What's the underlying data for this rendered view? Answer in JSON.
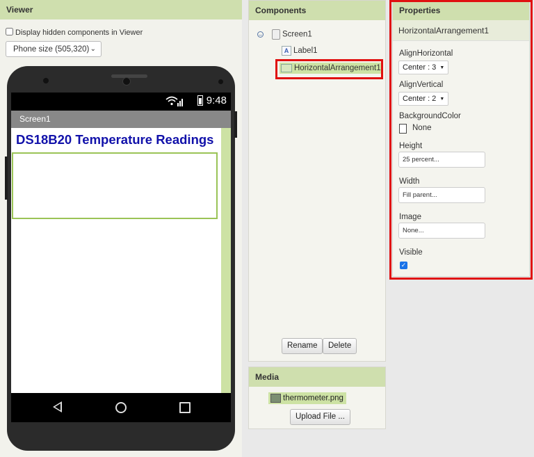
{
  "viewer": {
    "title": "Viewer",
    "hidden_components_label": "Display hidden components in Viewer",
    "phone_size": "Phone size (505,320)",
    "status_time": "9:48",
    "screen_title": "Screen1",
    "heading_text": "DS18B20 Temperature Readings"
  },
  "components": {
    "title": "Components",
    "tree": [
      {
        "label": "Screen1",
        "icon": "screen-icon"
      },
      {
        "label": "Label1",
        "icon": "label-icon",
        "icon_glyph": "A"
      },
      {
        "label": "HorizontalArrangement1",
        "icon": "horizontal-arrangement-icon",
        "selected": true
      }
    ],
    "collapse_glyph": "⊖",
    "rename_label": "Rename",
    "delete_label": "Delete"
  },
  "media": {
    "title": "Media",
    "file": "thermometer.png",
    "upload_label": "Upload File ..."
  },
  "properties": {
    "title": "Properties",
    "component_name": "HorizontalArrangement1",
    "align_horizontal_label": "AlignHorizontal",
    "align_horizontal_value": "Center : 3",
    "align_vertical_label": "AlignVertical",
    "align_vertical_value": "Center : 2",
    "background_color_label": "BackgroundColor",
    "background_color_value": "None",
    "height_label": "Height",
    "height_value": "25 percent...",
    "width_label": "Width",
    "width_value": "Fill parent...",
    "image_label": "Image",
    "image_value": "None...",
    "visible_label": "Visible",
    "visible_checked": true
  },
  "colors": {
    "panel_header": "#cfdfae",
    "selection": "#cde2a4",
    "highlight_border": "#e01010",
    "heading_text": "#1111aa"
  }
}
